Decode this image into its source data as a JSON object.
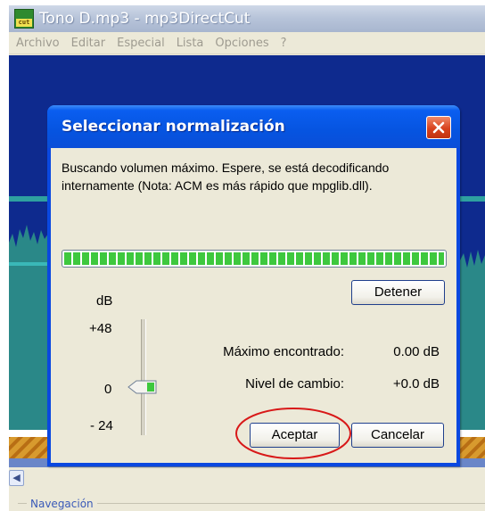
{
  "main_window": {
    "title": "Tono D.mp3 - mp3DirectCut",
    "icon_text": "cut",
    "menu": [
      "Archivo",
      "Editar",
      "Especial",
      "Lista",
      "Opciones",
      "?"
    ],
    "navigation_label": "Navegación"
  },
  "dialog": {
    "title": "Seleccionar normalización",
    "message": "Buscando volumen máximo. Espere, se está decodificando internamente (Nota: ACM es más rápido que mpglib.dll).",
    "progress_fraction": 1.0,
    "stop_label": "Detener",
    "scale": {
      "unit": "dB",
      "max": "+48",
      "zero": "0",
      "min": "- 24"
    },
    "max_found_label": "Máximo encontrado:",
    "max_found_value": "0.00 dB",
    "change_label": "Nivel de cambio:",
    "change_value": "+0.0 dB",
    "accept_label": "Aceptar",
    "cancel_label": "Cancelar"
  },
  "colors": {
    "waveform_bg": "#0e2a8e",
    "waveform": "#2a8888",
    "progress": "#3ec83e",
    "annotation": "#d81818"
  }
}
